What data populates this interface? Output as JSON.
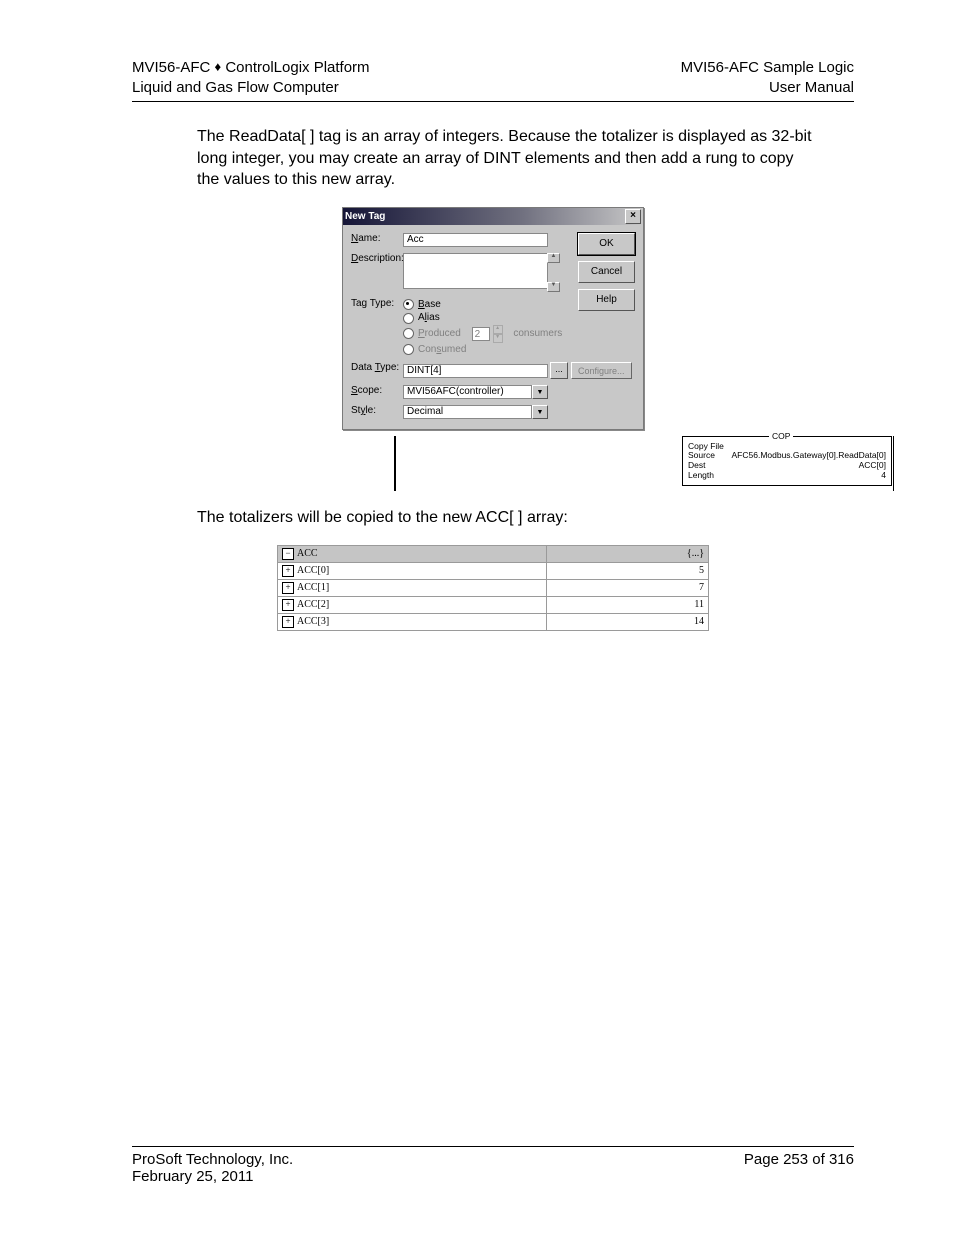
{
  "header": {
    "left1_a": "MVI56-AFC ",
    "left1_b": " ControlLogix Platform",
    "left2": "Liquid and Gas Flow Computer",
    "right1": "MVI56-AFC Sample Logic",
    "right2": "User Manual"
  },
  "para1": "The ReadData[ ] tag is an array of integers. Because the totalizer is displayed as 32-bit long integer, you may create an array of DINT elements and then add a rung to copy the values to this new array.",
  "dialog": {
    "title": "New Tag",
    "labels": {
      "name": "Name:",
      "description": "Description:",
      "tagtype": "Tag Type:",
      "datatype": "Data Type:",
      "scope": "Scope:",
      "style": "Style:"
    },
    "values": {
      "name": "Acc",
      "description": "",
      "datatype": "DINT[4]",
      "scope": "MVI56AFC(controller)",
      "style": "Decimal",
      "produced_n": "2"
    },
    "tagtype": {
      "base": "Base",
      "alias": "Alias",
      "produced": "Produced",
      "consumed": "Consumed",
      "consumers_suffix": "consumers"
    },
    "buttons": {
      "ok": "OK",
      "cancel": "Cancel",
      "help": "Help",
      "configure": "Configure...",
      "ellipsis": "..."
    }
  },
  "cop": {
    "legend": "COP",
    "title": "Copy File",
    "rows": {
      "source_l": "Source",
      "source_v": "AFC56.Modbus.Gateway[0].ReadData[0]",
      "dest_l": "Dest",
      "dest_v": "ACC[0]",
      "len_l": "Length",
      "len_v": "4"
    }
  },
  "para2": "The totalizers will be copied to the new ACC[ ] array:",
  "array": {
    "root": "ACC",
    "root_val": "{...}",
    "rows": [
      {
        "name": "ACC[0]",
        "val": "5"
      },
      {
        "name": "ACC[1]",
        "val": "7"
      },
      {
        "name": "ACC[2]",
        "val": "11"
      },
      {
        "name": "ACC[3]",
        "val": "14"
      }
    ]
  },
  "footer": {
    "company": "ProSoft Technology, Inc.",
    "date": "February 25, 2011",
    "page": "Page 253 of 316"
  }
}
